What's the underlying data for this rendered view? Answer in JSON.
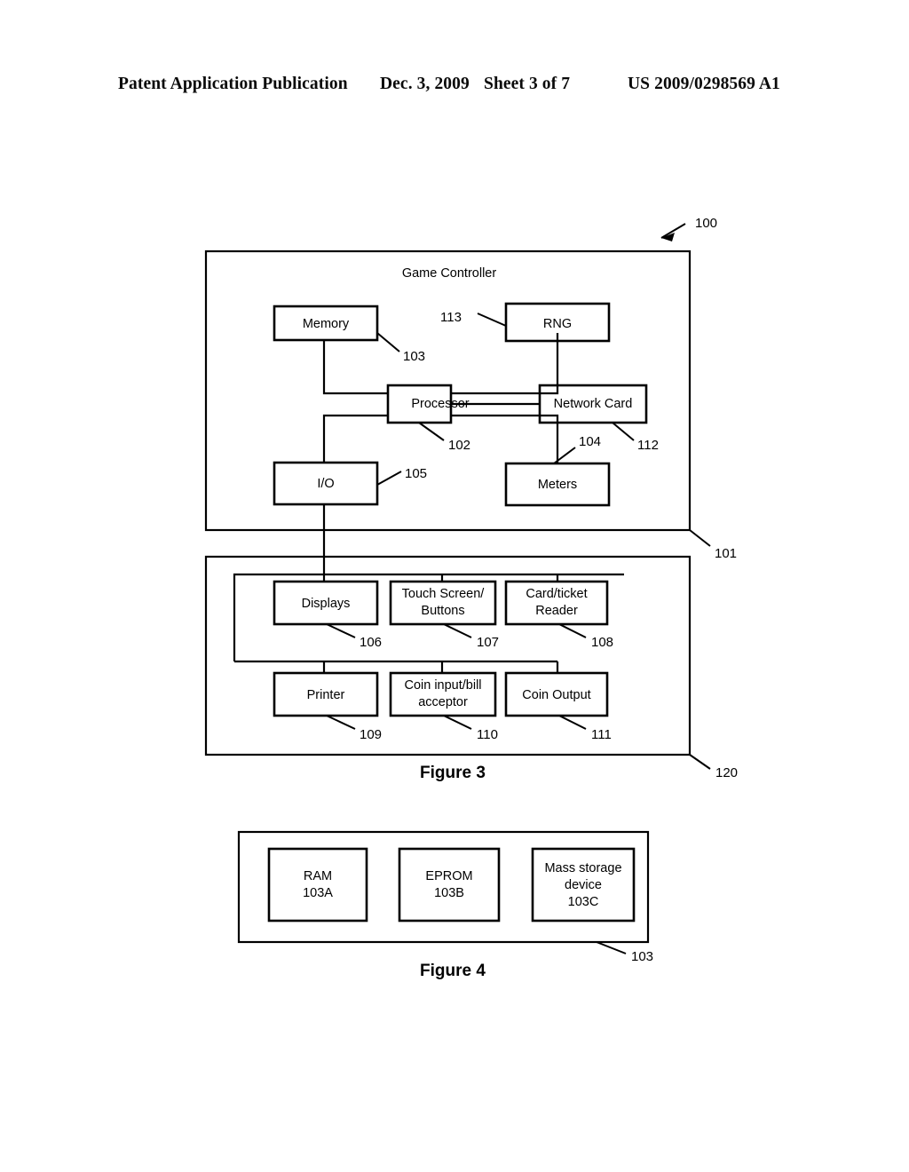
{
  "header": {
    "title": "Patent Application Publication",
    "date": "Dec. 3, 2009",
    "sheet": "Sheet 3 of 7",
    "publication_number": "US 2009/0298569 A1"
  },
  "figure3": {
    "caption": "Figure 3",
    "outer_refs": {
      "system": "100",
      "game_controller": "101",
      "cabinet": "120"
    },
    "game_controller": {
      "title": "Game Controller",
      "blocks": [
        {
          "label": "Memory",
          "ref": "103"
        },
        {
          "label": "RNG",
          "ref": "113"
        },
        {
          "label": "Processor",
          "ref": "102"
        },
        {
          "label": "Network Card",
          "ref": "112"
        },
        {
          "label": "I/O",
          "ref": "105"
        },
        {
          "label": "Meters",
          "ref": "104"
        }
      ]
    },
    "peripherals": {
      "blocks": [
        {
          "label": "Displays",
          "ref": "106"
        },
        {
          "label_line1": "Touch Screen/",
          "label_line2": "Buttons",
          "ref": "107"
        },
        {
          "label_line1": "Card/ticket",
          "label_line2": "Reader",
          "ref": "108"
        },
        {
          "label": "Printer",
          "ref": "109"
        },
        {
          "label_line1": "Coin input/bill",
          "label_line2": "acceptor",
          "ref": "110"
        },
        {
          "label": "Coin Output",
          "ref": "111"
        }
      ]
    }
  },
  "figure4": {
    "caption": "Figure 4",
    "outer_ref": "103",
    "blocks": [
      {
        "label_line1": "RAM",
        "label_line2": "103A"
      },
      {
        "label_line1": "EPROM",
        "label_line2": "103B"
      },
      {
        "label_line1": "Mass storage",
        "label_line2": "device",
        "label_line3": "103C"
      }
    ]
  }
}
